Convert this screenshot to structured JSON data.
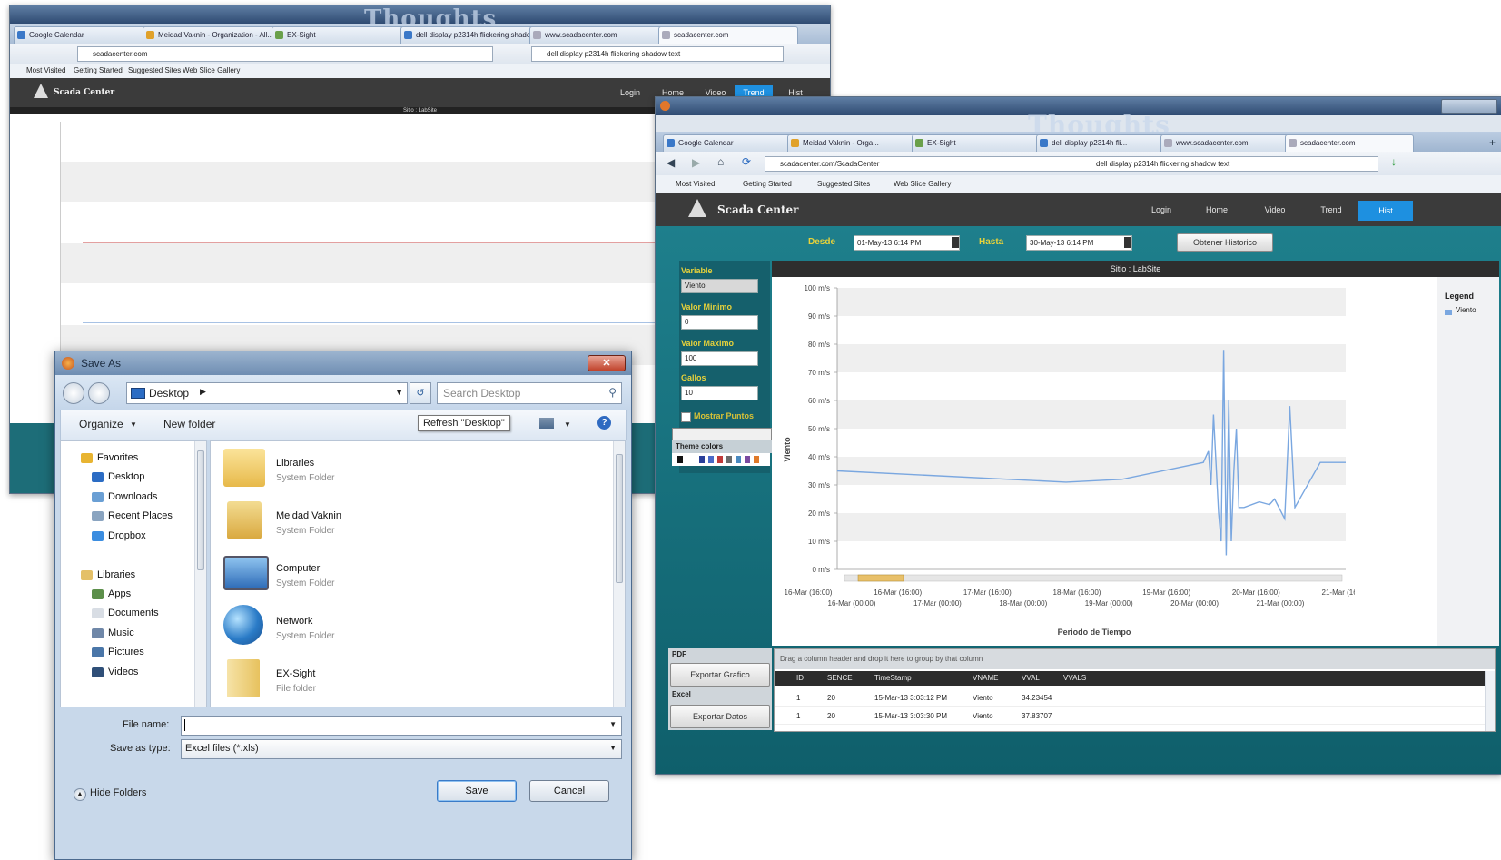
{
  "back_window": {
    "watermark": "Thoughts",
    "tabs": [
      "Google Calendar",
      "Meidad Vaknin - Organization - All...",
      "EX-Sight",
      "dell display p2314h flickering shadow...",
      "www.scadacenter.com",
      "scadacenter.com"
    ],
    "url": "scadacenter.com",
    "search": "dell display p2314h flickering shadow text",
    "bookmarks": [
      "Most Visited",
      "Getting Started",
      "Suggested Sites",
      "Web Slice Gallery"
    ],
    "app_title": "Scada Center",
    "menu": [
      "Login",
      "Home",
      "Video",
      "Trend",
      "Hist"
    ],
    "chart_title": "Sitio : LabSite"
  },
  "front_window": {
    "watermark": "Thoughts",
    "tabs": [
      "Google Calendar",
      "Meidad Vaknin - Orga...",
      "EX-Sight",
      "dell display p2314h fli...",
      "www.scadacenter.com",
      "scadacenter.com"
    ],
    "url": "scadacenter.com/ScadaCenter",
    "search": "dell display p2314h flickering shadow text",
    "bookmarks": [
      "Most Visited",
      "Getting Started",
      "Suggested Sites",
      "Web Slice Gallery"
    ],
    "app_title": "Scada Center",
    "menu": [
      "Login",
      "Home",
      "Video",
      "Trend",
      "Hist"
    ],
    "desde_label": "Desde",
    "desde_value": "01-May-13 6:14 PM",
    "hasta_label": "Hasta",
    "hasta_value": "30-May-13 6:14 PM",
    "obtener_button": "Obtener Historico",
    "variable_label": "Variable",
    "variable_value": "Viento",
    "min_label": "Valor Minimo",
    "min_value": "0",
    "max_label": "Valor Maximo",
    "max_value": "100",
    "gallos_label": "Gallos",
    "gallos_value": "10",
    "checkbox_label": "Mostrar Puntos",
    "theme_label": "Theme colors",
    "legend_title": "Legend",
    "export_graph_button": "Exportar Grafico",
    "export_data_button": "Exportar Datos",
    "pdf_label": "PDF",
    "excel_label": "Excel",
    "group_hint": "Drag a column header and drop it here to group by that column",
    "grid_headers": [
      "ID",
      "SENCE",
      "TimeStamp",
      "VNAME",
      "VVAL",
      "VVALS"
    ],
    "grid_rows": [
      [
        "1",
        "20",
        "15-Mar-13 3:03:12 PM",
        "Viento",
        "34.23454",
        ""
      ],
      [
        "1",
        "20",
        "15-Mar-13 3:03:30 PM",
        "Viento",
        "37.83707",
        ""
      ]
    ]
  },
  "chart_data": {
    "type": "line",
    "title": "Sitio : LabSite",
    "xlabel": "Periodo de Tiempo",
    "ylabel": "Viento",
    "ylim": [
      0,
      100
    ],
    "yticks": [
      "0 m/s",
      "10 m/s",
      "20 m/s",
      "30 m/s",
      "40 m/s",
      "50 m/s",
      "60 m/s",
      "70 m/s",
      "80 m/s",
      "90 m/s",
      "100 m/s"
    ],
    "xticks_top": [
      "16-Mar (16:00)",
      "16-Mar (16:00)",
      "17-Mar (16:00)",
      "18-Mar (16:00)",
      "19-Mar (16:00)",
      "20-Mar (16:00)",
      "21-Mar (16:00)"
    ],
    "xticks_bottom": [
      "16-Mar (00:00)",
      "17-Mar (00:00)",
      "18-Mar (00:00)",
      "19-Mar (00:00)",
      "20-Mar (00:00)",
      "21-Mar (00:00)"
    ],
    "legend": "top-right",
    "series": [
      {
        "name": "Viento",
        "color": "#7aa7e0",
        "x": [
          0.0,
          0.45,
          0.56,
          0.72,
          0.73,
          0.735,
          0.74,
          0.75,
          0.755,
          0.76,
          0.765,
          0.77,
          0.775,
          0.78,
          0.785,
          0.79,
          0.8,
          0.83,
          0.85,
          0.86,
          0.88,
          0.89,
          0.9,
          0.95,
          1.0
        ],
        "y": [
          35,
          31,
          32,
          38,
          42,
          30,
          55,
          20,
          10,
          78,
          5,
          60,
          10,
          35,
          50,
          22,
          22,
          24,
          23,
          25,
          18,
          58,
          22,
          38,
          38
        ]
      }
    ]
  },
  "dialog": {
    "title": "Save As",
    "location": "Desktop",
    "search_placeholder": "Search Desktop",
    "organize": "Organize",
    "new_folder": "New folder",
    "refresh_tooltip": "Refresh \"Desktop\"",
    "nav_favorites": "Favorites",
    "nav_items_fav": [
      "Desktop",
      "Downloads",
      "Recent Places",
      "Dropbox"
    ],
    "nav_libraries": "Libraries",
    "nav_items_lib": [
      "Apps",
      "Documents",
      "Music",
      "Pictures",
      "Videos"
    ],
    "files": [
      {
        "name": "Libraries",
        "type": "System Folder"
      },
      {
        "name": "Meidad Vaknin",
        "type": "System Folder"
      },
      {
        "name": "Computer",
        "type": "System Folder"
      },
      {
        "name": "Network",
        "type": "System Folder"
      },
      {
        "name": "EX-Sight",
        "type": "File folder"
      }
    ],
    "filename_label": "File name:",
    "filename_value": "",
    "savetype_label": "Save as type:",
    "savetype_value": "Excel files (*.xls)",
    "hide_folders": "Hide Folders",
    "save_button": "Save",
    "cancel_button": "Cancel"
  }
}
